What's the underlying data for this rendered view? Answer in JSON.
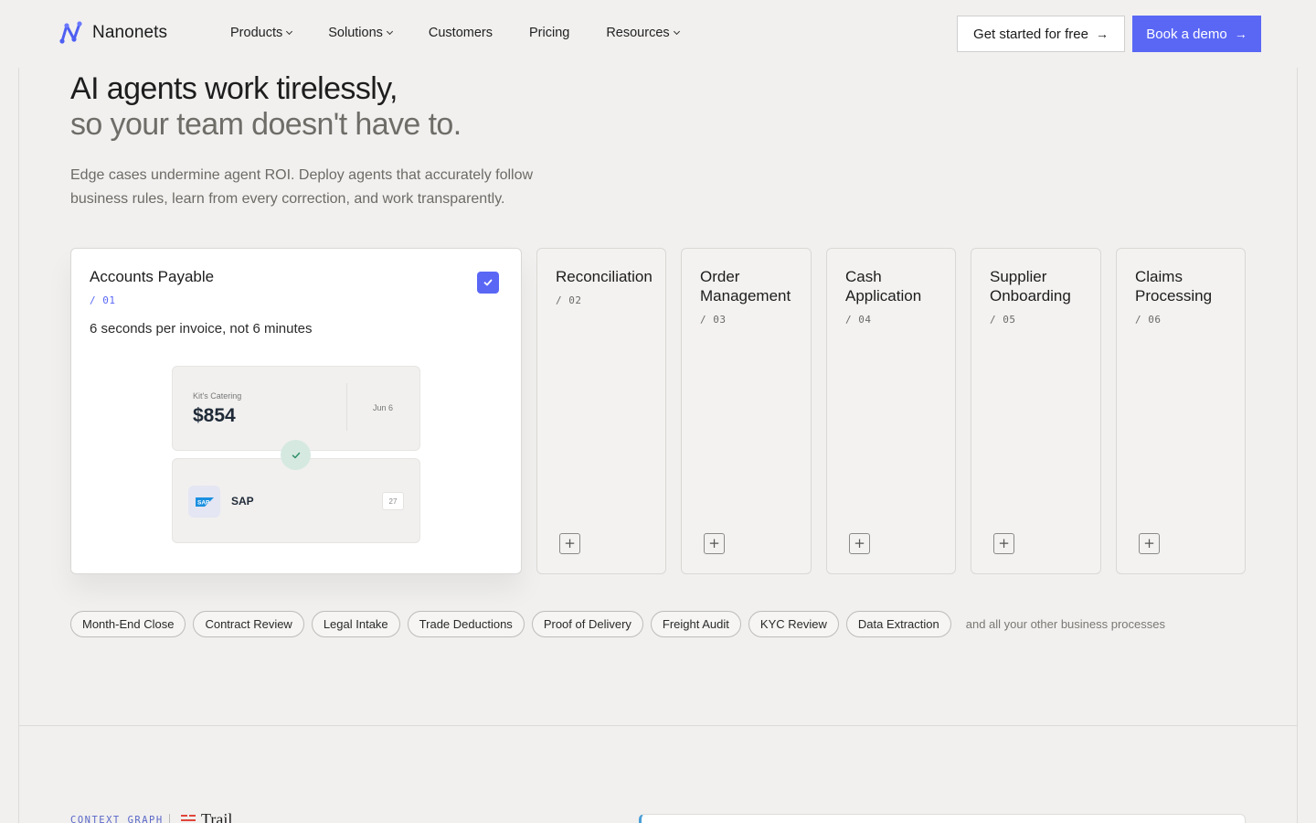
{
  "nav": {
    "brand": "Nanonets",
    "links": [
      {
        "label": "Products",
        "dropdown": true
      },
      {
        "label": "Solutions",
        "dropdown": true
      },
      {
        "label": "Customers",
        "dropdown": false
      },
      {
        "label": "Pricing",
        "dropdown": false
      },
      {
        "label": "Resources",
        "dropdown": true
      }
    ],
    "cta_secondary": "Get started for free",
    "cta_primary": "Book a demo",
    "arrow": "→"
  },
  "hero": {
    "title_line1": "AI agents work tirelessly,",
    "title_line2": "so your team doesn't have to.",
    "lead": "Edge cases undermine agent ROI. Deploy agents that accurately follow business rules, learn from every correction, and work transparently."
  },
  "cards": {
    "active": {
      "title": "Accounts Payable",
      "num": "/ 01",
      "subtitle": "6 seconds per invoice, not 6 minutes",
      "invoice": {
        "vendor": "Kit's Catering",
        "amount": "$854",
        "date": "Jun 6"
      },
      "erp": {
        "name": "SAP",
        "badge": "27"
      }
    },
    "items": [
      {
        "title": "Reconciliation",
        "num": "/ 02"
      },
      {
        "title": "Order Management",
        "num": "/ 03"
      },
      {
        "title": "Cash Application",
        "num": "/ 04"
      },
      {
        "title": "Supplier Onboarding",
        "num": "/ 05"
      },
      {
        "title": "Claims Processing",
        "num": "/ 06"
      }
    ],
    "plus": "+"
  },
  "pills": [
    "Month-End Close",
    "Contract Review",
    "Legal Intake",
    "Trade Deductions",
    "Proof of Delivery",
    "Freight Audit",
    "KYC Review",
    "Data Extraction"
  ],
  "pills_tail": "and all your other business processes",
  "bottom": {
    "label": "CONTEXT GRAPH",
    "trail": "Trail"
  },
  "colors": {
    "accent": "#5a67f5",
    "background": "#f1f0ef",
    "success": "#d5e9e1"
  }
}
